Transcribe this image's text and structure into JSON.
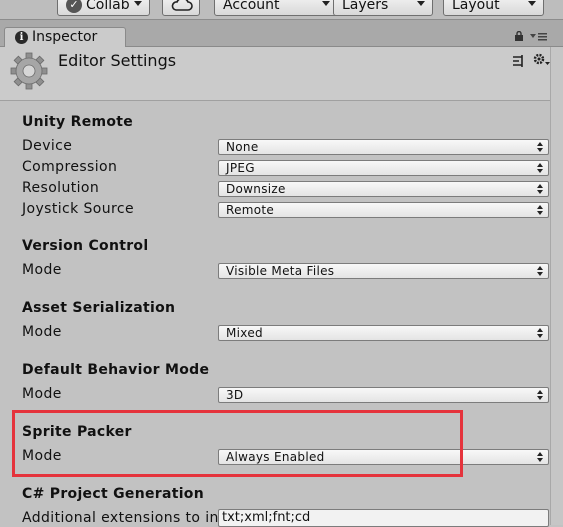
{
  "toolbar": {
    "collab_label": "Collab",
    "account_label": "Account",
    "layers_label": "Layers",
    "layout_label": "Layout"
  },
  "tab": {
    "inspector_label": "Inspector"
  },
  "header": {
    "title": "Editor Settings"
  },
  "sections": {
    "unity_remote": {
      "title": "Unity Remote",
      "device_label": "Device",
      "device_value": "None",
      "compression_label": "Compression",
      "compression_value": "JPEG",
      "resolution_label": "Resolution",
      "resolution_value": "Downsize",
      "joystick_label": "Joystick Source",
      "joystick_value": "Remote"
    },
    "version_control": {
      "title": "Version Control",
      "mode_label": "Mode",
      "mode_value": "Visible Meta Files"
    },
    "asset_serialization": {
      "title": "Asset Serialization",
      "mode_label": "Mode",
      "mode_value": "Mixed"
    },
    "default_behavior": {
      "title": "Default Behavior Mode",
      "mode_label": "Mode",
      "mode_value": "3D"
    },
    "sprite_packer": {
      "title": "Sprite Packer",
      "mode_label": "Mode",
      "mode_value": "Always Enabled"
    },
    "csharp_project": {
      "title": "C# Project Generation",
      "extensions_label": "Additional extensions to incl",
      "extensions_value": "txt;xml;fnt;cd"
    }
  },
  "colors": {
    "highlight": "#e5333c",
    "panel_bg": "#c2c2c2"
  }
}
